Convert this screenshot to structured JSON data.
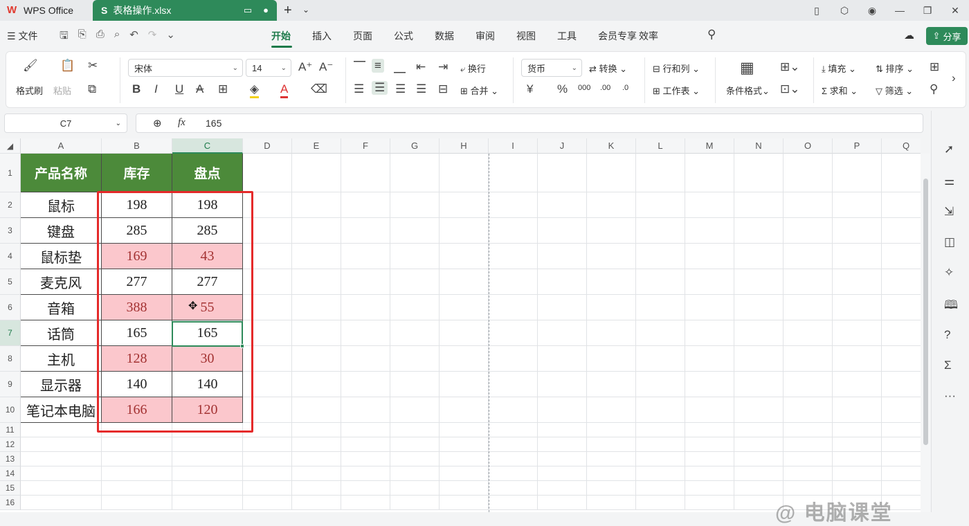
{
  "app": {
    "name": "WPS Office",
    "file_tab": "表格操作.xlsx",
    "file_icon_letter": "S"
  },
  "menu": {
    "file": "文件",
    "tabs": [
      "开始",
      "插入",
      "页面",
      "公式",
      "数据",
      "审阅",
      "视图",
      "工具",
      "会员专享",
      "效率"
    ],
    "active_tab": "开始",
    "share": "分享"
  },
  "ribbon": {
    "format_painter": "格式刷",
    "paste": "粘贴",
    "font": "宋体",
    "font_size": "14",
    "wrap": "换行",
    "merge": "合并",
    "number_format": "货币",
    "convert": "转换",
    "row_col": "行和列",
    "worksheet": "工作表",
    "cond_format": "条件格式",
    "fill": "填充",
    "sort": "排序",
    "sum": "求和",
    "filter": "筛选"
  },
  "formula_bar": {
    "cell_ref": "C7",
    "fx": "fx",
    "value": "165"
  },
  "columns": [
    "A",
    "B",
    "C",
    "D",
    "E",
    "F",
    "G",
    "H",
    "I",
    "J",
    "K",
    "L",
    "M",
    "N",
    "O",
    "P",
    "Q"
  ],
  "rows": [
    "1",
    "2",
    "3",
    "4",
    "5",
    "6",
    "7",
    "8",
    "9",
    "10",
    "11",
    "12",
    "13",
    "14",
    "15",
    "16"
  ],
  "selected": {
    "column": "C",
    "row": "7"
  },
  "table": {
    "headers": [
      "产品名称",
      "库存",
      "盘点"
    ],
    "rows": [
      {
        "name": "鼠标",
        "stock": "198",
        "count": "198",
        "mismatch": false
      },
      {
        "name": "键盘",
        "stock": "285",
        "count": "285",
        "mismatch": false
      },
      {
        "name": "鼠标垫",
        "stock": "169",
        "count": "43",
        "mismatch": true
      },
      {
        "name": "麦克风",
        "stock": "277",
        "count": "277",
        "mismatch": false
      },
      {
        "name": "音箱",
        "stock": "388",
        "count": "55",
        "mismatch": true
      },
      {
        "name": "话筒",
        "stock": "165",
        "count": "165",
        "mismatch": false
      },
      {
        "name": "主机",
        "stock": "128",
        "count": "30",
        "mismatch": true
      },
      {
        "name": "显示器",
        "stock": "140",
        "count": "140",
        "mismatch": false
      },
      {
        "name": "笔记本电脑",
        "stock": "166",
        "count": "120",
        "mismatch": true
      }
    ]
  },
  "colors": {
    "accent": "#2e8a5a",
    "header_fill": "#4c8a3a",
    "mismatch_fill": "#fbc7cc",
    "highlight_box": "#e52a2a"
  },
  "watermark": "@ 电脑课堂"
}
